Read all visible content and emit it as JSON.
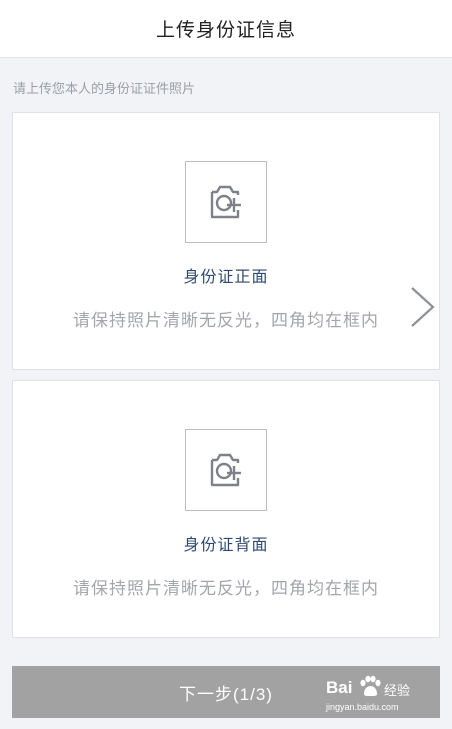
{
  "header": {
    "title": "上传身份证信息"
  },
  "hint": "请上传您本人的身份证证件照片",
  "cards": {
    "front": {
      "title": "身份证正面",
      "desc": "请保持照片清晰无反光，四角均在框内"
    },
    "back": {
      "title": "身份证背面",
      "desc": "请保持照片清晰无反光，四角均在框内"
    }
  },
  "next_button": {
    "label": "下一步(1/3)"
  },
  "watermark": {
    "brand_left": "Bai",
    "brand_right": "经验",
    "url": "jingyan.baidu.com"
  },
  "icons": {
    "camera": "camera-plus-icon",
    "chevron": "chevron-right-icon",
    "paw": "baidu-paw-icon"
  },
  "colors": {
    "background": "#f2f3f7",
    "card_title": "#2f4a6e",
    "button": "#a2a2a3",
    "hint_text": "#9a9ea8"
  }
}
